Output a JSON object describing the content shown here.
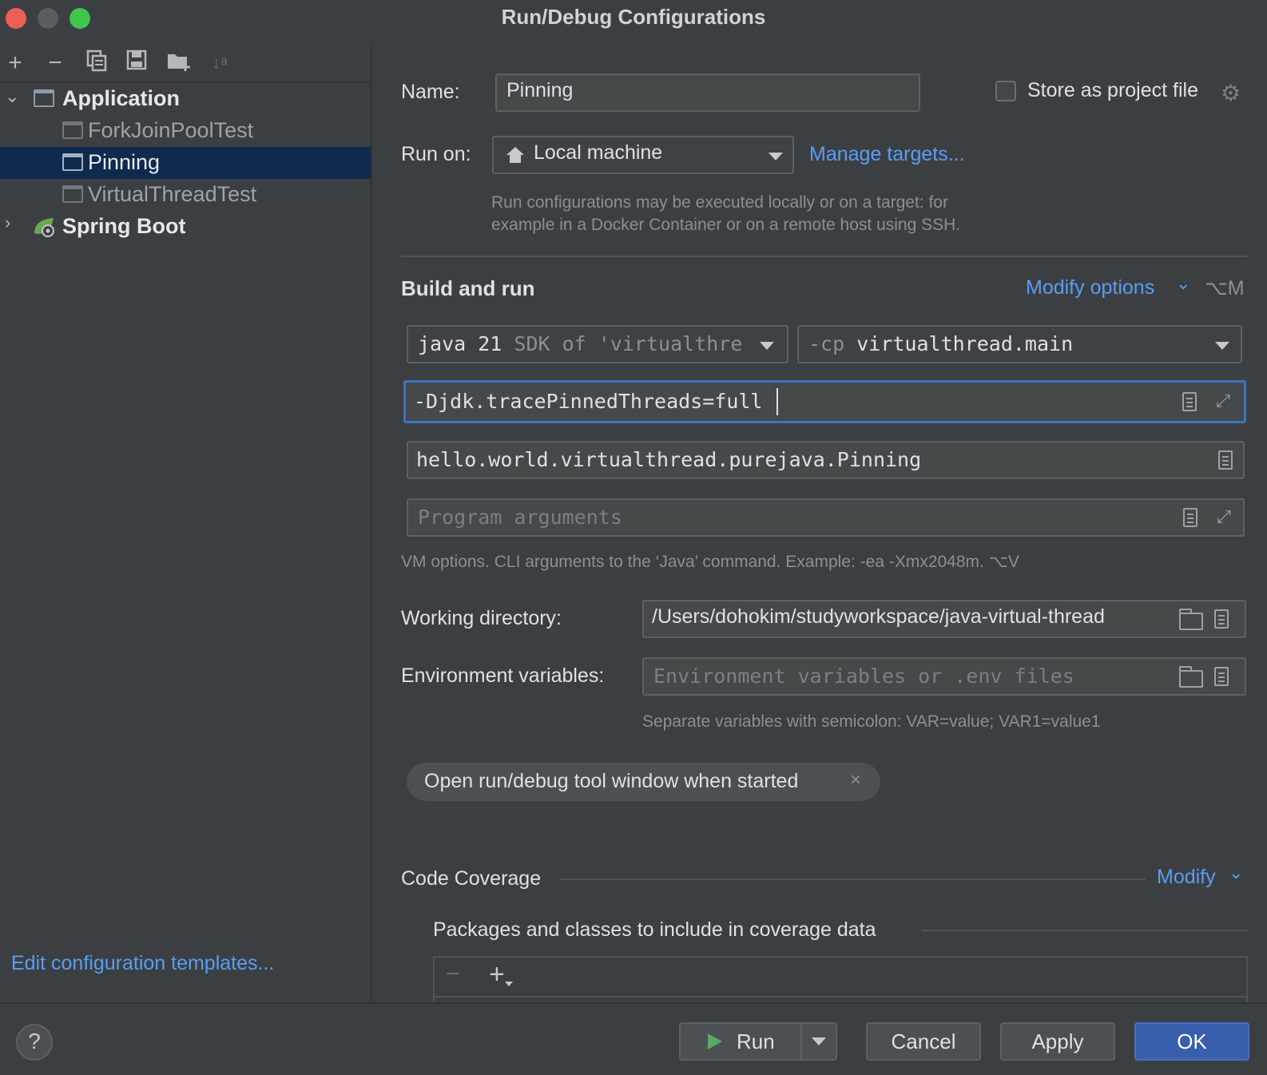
{
  "window": {
    "title": "Run/Debug Configurations"
  },
  "left": {
    "toolbar_icons": [
      "add-icon",
      "remove-icon",
      "copy-icon",
      "save-icon",
      "new-folder-icon",
      "sort-icon"
    ],
    "tree": [
      {
        "label": "Application",
        "type": "group",
        "expanded": true
      },
      {
        "label": "ForkJoinPoolTest",
        "type": "item"
      },
      {
        "label": "Pinning",
        "type": "item",
        "selected": true
      },
      {
        "label": "VirtualThreadTest",
        "type": "item"
      },
      {
        "label": "Spring Boot",
        "type": "group",
        "expanded": false
      }
    ],
    "edit_templates_link": "Edit configuration templates..."
  },
  "form": {
    "name_label": "Name:",
    "name_value": "Pinning",
    "store_as_project_file": "Store as project file",
    "run_on_label": "Run on:",
    "run_on_value": "Local machine",
    "manage_targets": "Manage targets...",
    "run_on_hint_line1": "Run configurations may be executed locally or on a target: for",
    "run_on_hint_line2": "example in a Docker Container or on a remote host using SSH.",
    "build_and_run": "Build and run",
    "modify_options": "Modify options",
    "modify_options_shortcut": "⌥M",
    "jdk_main": "java 21",
    "jdk_sub": "SDK of 'virtualthre",
    "cp_prefix": "-cp",
    "cp_value": "virtualthread.main",
    "vm_options": "-Djdk.tracePinnedThreads=full",
    "main_class": "hello.world.virtualthread.purejava.Pinning",
    "program_args_placeholder": "Program arguments",
    "vm_hint": "VM options. CLI arguments to the ‘Java’ command. Example: -ea -Xmx2048m. ⌥V",
    "working_dir_label": "Working directory:",
    "working_dir_value": "/Users/dohokim/studyworkspace/java-virtual-thread",
    "env_label": "Environment variables:",
    "env_placeholder": "Environment variables or .env files",
    "env_hint": "Separate variables with semicolon: VAR=value; VAR1=value1",
    "chip_label": "Open run/debug tool window when started",
    "code_coverage": "Code Coverage",
    "modify": "Modify",
    "packages_label": "Packages and classes to include in coverage data"
  },
  "buttons": {
    "help": "?",
    "run": "Run",
    "cancel": "Cancel",
    "apply": "Apply",
    "ok": "OK"
  },
  "colors": {
    "background": "#3c3f41",
    "selection": "#0f2a4e",
    "link": "#589df6",
    "focus_border": "#3d73c2",
    "primary_button": "#375fad",
    "run_icon": "#59a869"
  }
}
